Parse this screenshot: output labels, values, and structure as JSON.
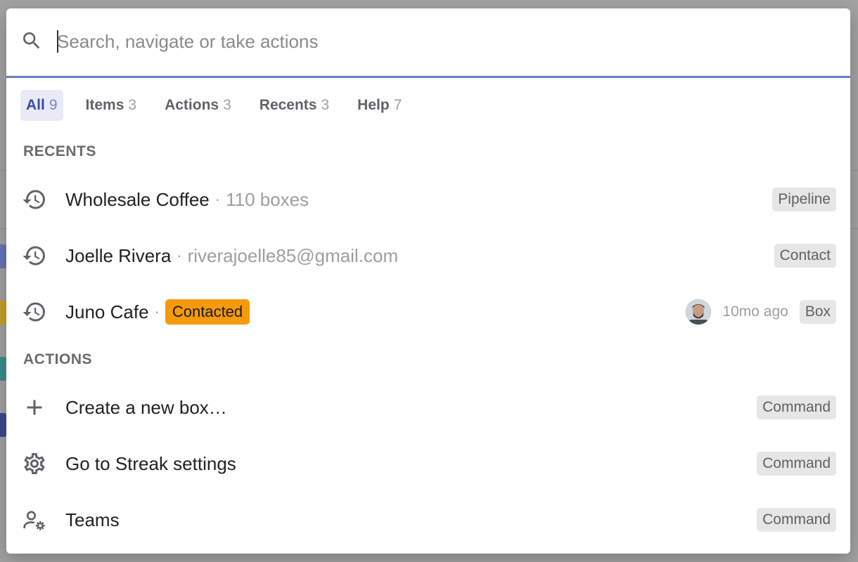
{
  "search": {
    "placeholder": "Search, navigate or take actions",
    "value": ""
  },
  "tabs": [
    {
      "label": "All",
      "count": "9",
      "active": true
    },
    {
      "label": "Items",
      "count": "3"
    },
    {
      "label": "Actions",
      "count": "3"
    },
    {
      "label": "Recents",
      "count": "3"
    },
    {
      "label": "Help",
      "count": "7"
    }
  ],
  "sections": {
    "recents": "RECENTS",
    "actions": "ACTIONS"
  },
  "recents": [
    {
      "icon": "history-icon",
      "title": "Wholesale Coffee",
      "separator": "·",
      "subtitle": "110 boxes",
      "type": "Pipeline"
    },
    {
      "icon": "history-icon",
      "title": "Joelle Rivera",
      "separator": "·",
      "subtitle": "riverajoelle85@gmail.com",
      "type": "Contact"
    },
    {
      "icon": "history-icon",
      "title": "Juno Cafe",
      "separator": "·",
      "status": "Contacted",
      "status_color": "#f59a0b",
      "time": "10mo ago",
      "type": "Box"
    }
  ],
  "actions": [
    {
      "icon": "plus-icon",
      "title": "Create a new box…",
      "type": "Command"
    },
    {
      "icon": "gear-icon",
      "title": "Go to Streak settings",
      "type": "Command"
    },
    {
      "icon": "team-settings-icon",
      "title": "Teams",
      "type": "Command"
    }
  ],
  "colors": {
    "accent": "#3949ab",
    "search_underline": "#6b7cc8",
    "status_orange": "#f59a0b"
  }
}
